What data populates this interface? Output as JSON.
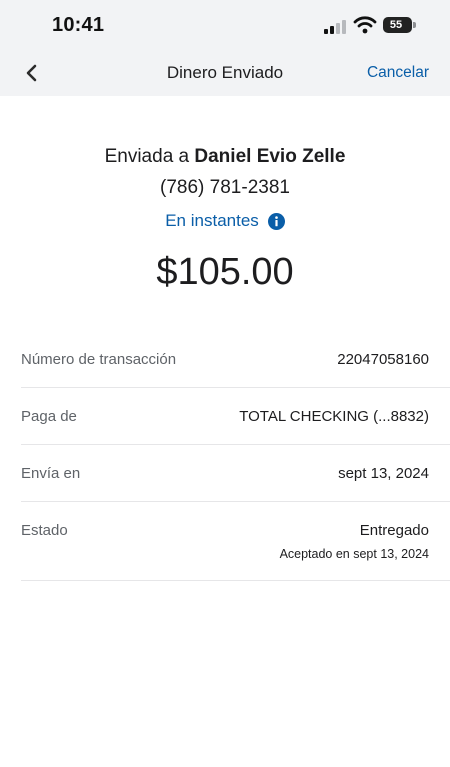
{
  "status_bar": {
    "time": "10:41",
    "battery_level": "55"
  },
  "nav": {
    "title": "Dinero Enviado",
    "cancel_label": "Cancelar",
    "back_icon": "chevron-left-icon"
  },
  "summary": {
    "sent_prefix": "Enviada a",
    "recipient_name": "Daniel Evio Zelle",
    "phone": "(786) 781-2381",
    "delivery_speed": "En instantes",
    "info_icon": "info-circle-icon",
    "amount": "$105.00"
  },
  "details": {
    "transaction_label": "Número de transacción",
    "transaction_value": "22047058160",
    "pay_from_label": "Paga de",
    "pay_from_value": "TOTAL CHECKING (...8832)",
    "send_on_label": "Envía en",
    "send_on_value": "sept 13, 2024",
    "status_label": "Estado",
    "status_value": "Entregado",
    "status_detail": "Aceptado en sept 13, 2024"
  },
  "colors": {
    "accent": "#0a5ea8",
    "header_bg": "#f2f3f5",
    "text": "#1d1d1f",
    "label": "#5f6368",
    "divider": "#e6e6e8"
  }
}
